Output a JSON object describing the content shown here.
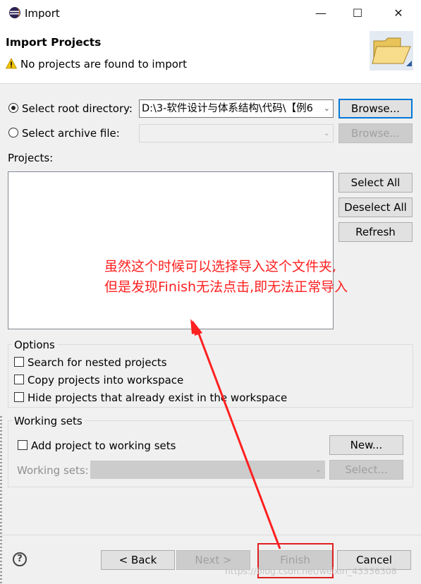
{
  "window": {
    "title": "Import",
    "minimize_icon": "minimize-icon",
    "maximize_icon": "maximize-icon",
    "close_icon": "close-icon"
  },
  "banner": {
    "title": "Import Projects",
    "message": "No projects are found to import",
    "warning_icon": "warning-icon",
    "wizard_icon": "folder-icon"
  },
  "source": {
    "root_label": "Select root directory:",
    "root_value": "D:\\3-软件设计与体系结构\\代码\\【例6",
    "root_selected": true,
    "root_browse": "Browse...",
    "archive_label": "Select archive file:",
    "archive_value": "",
    "archive_browse": "Browse..."
  },
  "projects": {
    "label": "Projects:",
    "select_all": "Select All",
    "deselect_all": "Deselect All",
    "refresh": "Refresh"
  },
  "annotation": {
    "line1": "虽然这个时候可以选择导入这个文件夹,",
    "line2": "但是发现Finish无法点击,即无法正常导入",
    "color": "#ff2020"
  },
  "options": {
    "title": "Options",
    "nested": "Search for nested projects",
    "copy": "Copy projects into workspace",
    "hide": "Hide projects that already exist in the workspace"
  },
  "working_sets": {
    "title": "Working sets",
    "add": "Add project to working sets",
    "new_button": "New...",
    "sets_label": "Working sets:",
    "select_button": "Select..."
  },
  "footer": {
    "help_icon": "help-icon",
    "help_glyph": "?",
    "back": "< Back",
    "next": "Next >",
    "finish": "Finish",
    "cancel": "Cancel",
    "watermark": "https://blog.csdn.net/weixin_43336308"
  }
}
